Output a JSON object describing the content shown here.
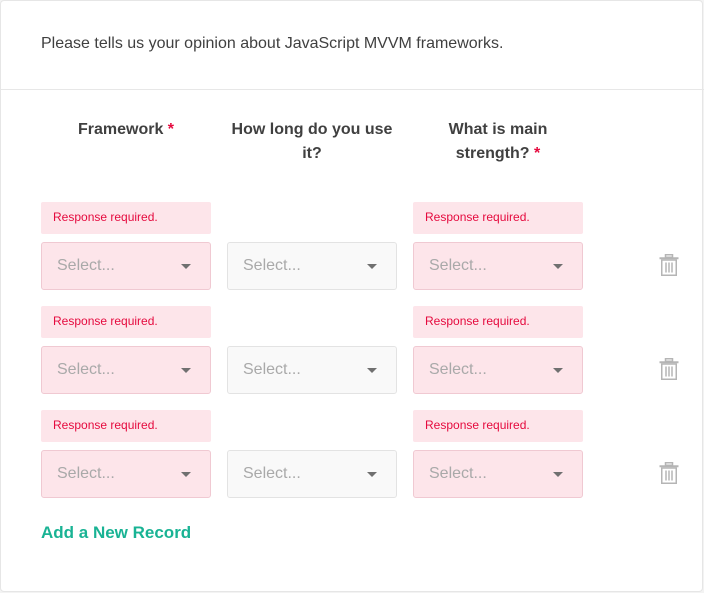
{
  "question": "Please tells us your opinion about JavaScript MVVM frameworks.",
  "columns": [
    {
      "line1": "Framework",
      "line2": "",
      "required": true
    },
    {
      "line1": "How long do you use",
      "line2": "it?",
      "required": false
    },
    {
      "line1": "What is main",
      "line2": "strength?",
      "required": true
    }
  ],
  "required_mark": "*",
  "error_text": "Response required.",
  "select_placeholder": "Select...",
  "add_record_label": "Add a New Record",
  "colors": {
    "accent": "#19b394",
    "error": "#e50a3e",
    "error_bg": "#fde5ea"
  },
  "icons": {
    "remove": "trash-icon",
    "dropdown": "chevron-down-icon"
  }
}
